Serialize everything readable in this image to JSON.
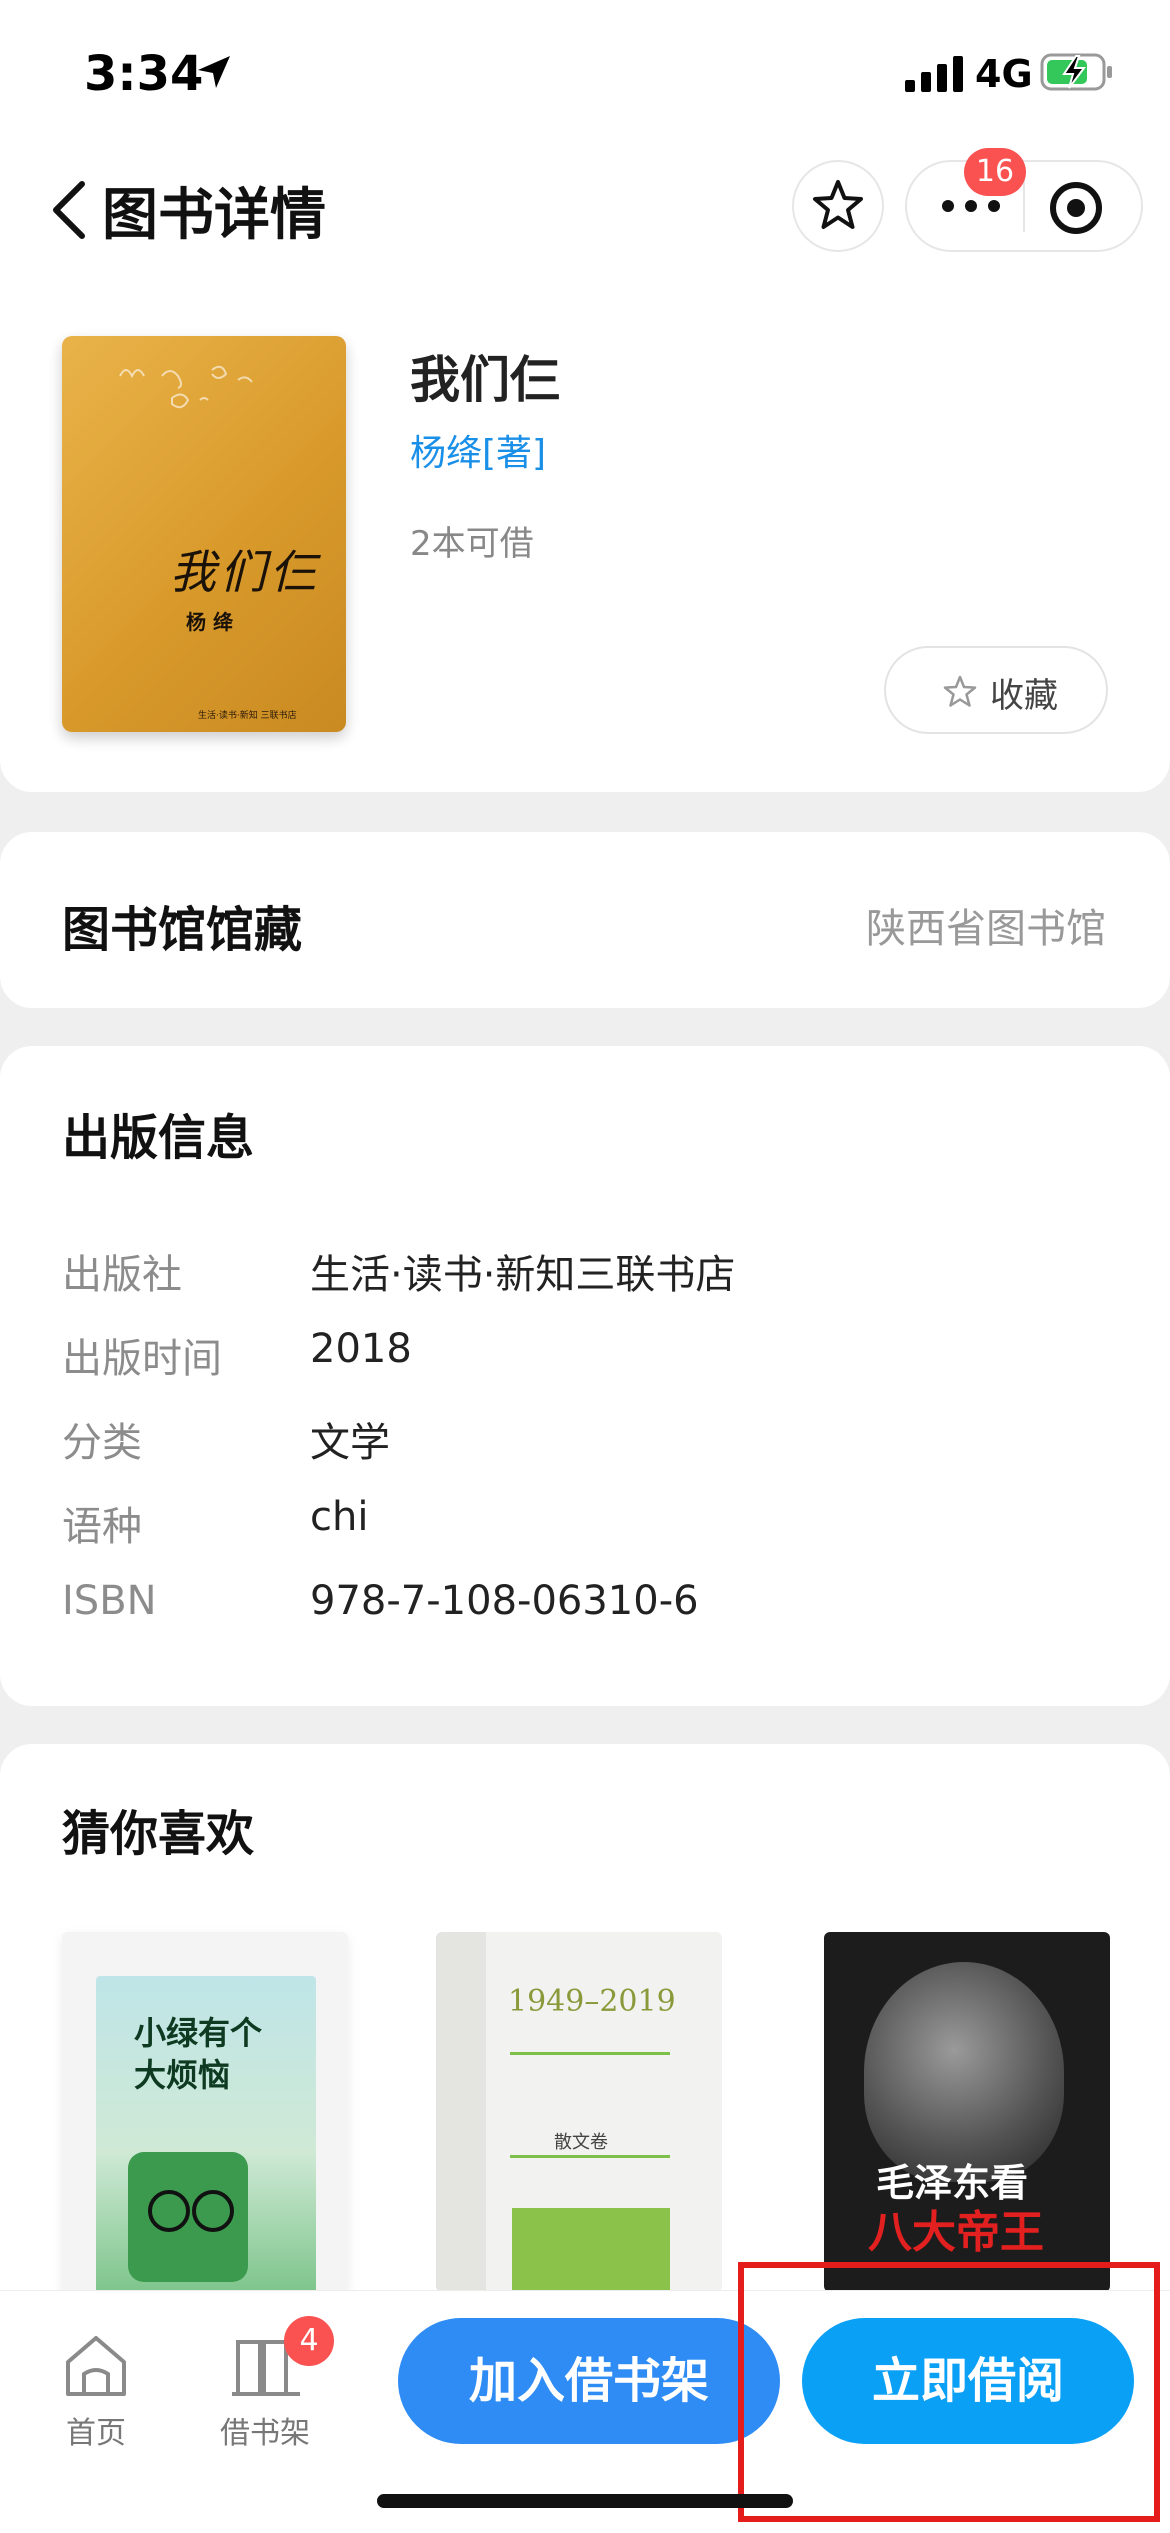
{
  "status_bar": {
    "time": "3:34",
    "network": "4G"
  },
  "header": {
    "title": "图书详情",
    "badge_count": "16"
  },
  "book": {
    "title": "我们仨",
    "author": "杨绛[著]",
    "availability": "2本可借",
    "favorite_label": "收藏",
    "cover_title": "我们仨",
    "cover_author": "杨 绛",
    "cover_publisher": "生活·读书·新知 三联书店"
  },
  "library": {
    "label": "图书馆馆藏",
    "value": "陕西省图书馆"
  },
  "publish_info": {
    "title": "出版信息",
    "rows": [
      {
        "label": "出版社",
        "value": "生活·读书·新知三联书店"
      },
      {
        "label": "出版时间",
        "value": "2018"
      },
      {
        "label": "分类",
        "value": "文学"
      },
      {
        "label": "语种",
        "value": "chi"
      },
      {
        "label": "ISBN",
        "value": "978-7-108-06310-6"
      }
    ]
  },
  "recommendations": {
    "title": "猜你喜欢",
    "items": [
      {
        "cover_text": "小绿有个大烦恼"
      },
      {
        "cover_text": "1949–2019",
        "cover_sub": "散文卷"
      },
      {
        "cover_text": "毛泽东看",
        "cover_sub": "八大帝王"
      }
    ]
  },
  "bottom_bar": {
    "home_label": "首页",
    "shelf_label": "借书架",
    "shelf_badge": "4",
    "add_button": "加入借书架",
    "borrow_button": "立即借阅"
  },
  "colors": {
    "accent_blue": "#1a8fe8",
    "button_blue": "#2f8cf5",
    "button_cyan": "#0aa0f5",
    "badge_red": "#fa5151",
    "highlight_red": "#e51c1c"
  }
}
